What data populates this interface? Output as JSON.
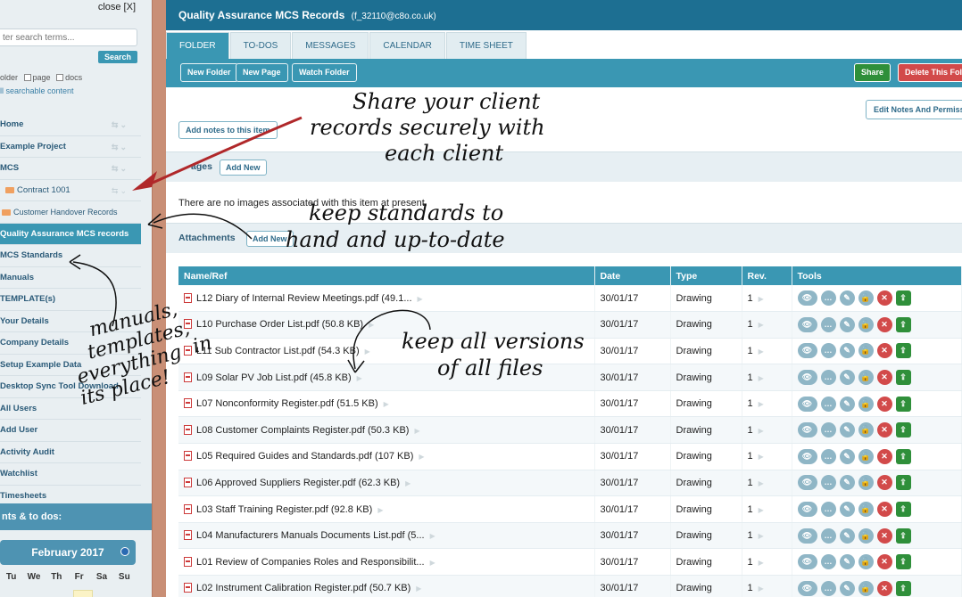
{
  "sidebar": {
    "close_label": "close [X]",
    "search": {
      "placeholder": "ter search terms..."
    },
    "search_button": "Search",
    "filters": [
      "older",
      "page",
      "docs"
    ],
    "all_searchable": "ll searchable content",
    "nav": [
      {
        "label": "Home",
        "type": "item"
      },
      {
        "label": "Example Project",
        "type": "item"
      },
      {
        "label": "MCS",
        "type": "item"
      },
      {
        "label": "Contract 1001",
        "type": "child"
      },
      {
        "label": "Customer Handover Records",
        "type": "grandchild"
      },
      {
        "label": "Quality Assurance MCS records",
        "type": "active"
      },
      {
        "label": "MCS Standards",
        "type": "item"
      },
      {
        "label": "Manuals",
        "type": "item"
      },
      {
        "label": "TEMPLATE(s)",
        "type": "item"
      },
      {
        "label": "Your Details",
        "type": "item"
      },
      {
        "label": "Company Details",
        "type": "item"
      },
      {
        "label": "Setup Example Data",
        "type": "item"
      },
      {
        "label": "Desktop Sync Tool Download",
        "type": "item"
      },
      {
        "label": "All Users",
        "type": "item"
      },
      {
        "label": "Add User",
        "type": "item"
      },
      {
        "label": "Activity Audit",
        "type": "item"
      },
      {
        "label": "Watchlist",
        "type": "item"
      },
      {
        "label": "Timesheets",
        "type": "item"
      }
    ],
    "events_header": "nts & to dos:",
    "calendar": {
      "month": "February 2017",
      "days": [
        "Tu",
        "We",
        "Th",
        "Fr",
        "Sa",
        "Su"
      ]
    }
  },
  "header": {
    "title": "Quality Assurance MCS Records",
    "subtitle": "(f_32110@c8o.co.uk)"
  },
  "tabs": [
    {
      "label": "FOLDER",
      "active": true
    },
    {
      "label": "TO-DOS",
      "active": false
    },
    {
      "label": "MESSAGES",
      "active": false
    },
    {
      "label": "CALENDAR",
      "active": false
    },
    {
      "label": "TIME SHEET",
      "active": false
    }
  ],
  "toolbar": {
    "new_folder": "New Folder",
    "new_page": "New Page",
    "watch_folder": "Watch Folder",
    "share": "Share",
    "delete": "Delete This Fold"
  },
  "notes": {
    "edit_notes": "Edit Notes And Permissio",
    "add_notes": "Add notes to this item"
  },
  "images_section": {
    "label": "ages",
    "add_button": "Add New",
    "empty_text": "There are no images associated with this item at present."
  },
  "attachments_section": {
    "label": "Attachments",
    "add_button": "Add New"
  },
  "table": {
    "columns": [
      "Name/Ref",
      "Date",
      "Type",
      "Rev.",
      "Tools"
    ],
    "rows": [
      {
        "name": "L12 Diary of Internal Review Meetings.pdf (49.1...",
        "date": "30/01/17",
        "type": "Drawing",
        "rev": "1"
      },
      {
        "name": "L10 Purchase Order List.pdf (50.8 KB)",
        "date": "30/01/17",
        "type": "Drawing",
        "rev": "1"
      },
      {
        "name": "L11 Sub Contractor List.pdf (54.3 KB)",
        "date": "30/01/17",
        "type": "Drawing",
        "rev": "1"
      },
      {
        "name": "L09 Solar PV Job List.pdf (45.8 KB)",
        "date": "30/01/17",
        "type": "Drawing",
        "rev": "1"
      },
      {
        "name": "L07 Nonconformity Register.pdf (51.5 KB)",
        "date": "30/01/17",
        "type": "Drawing",
        "rev": "1"
      },
      {
        "name": "L08 Customer Complaints Register.pdf (50.3 KB)",
        "date": "30/01/17",
        "type": "Drawing",
        "rev": "1"
      },
      {
        "name": "L05 Required Guides and Standards.pdf (107 KB)",
        "date": "30/01/17",
        "type": "Drawing",
        "rev": "1"
      },
      {
        "name": "L06 Approved Suppliers Register.pdf (62.3 KB)",
        "date": "30/01/17",
        "type": "Drawing",
        "rev": "1"
      },
      {
        "name": "L03 Staff Training Register.pdf (92.8 KB)",
        "date": "30/01/17",
        "type": "Drawing",
        "rev": "1"
      },
      {
        "name": "L04 Manufacturers Manuals Documents List.pdf (5...",
        "date": "30/01/17",
        "type": "Drawing",
        "rev": "1"
      },
      {
        "name": "L01 Review of Companies Roles and Responsibilit...",
        "date": "30/01/17",
        "type": "Drawing",
        "rev": "1"
      },
      {
        "name": "L02 Instrument Calibration Register.pdf (50.7 KB)",
        "date": "30/01/17",
        "type": "Drawing",
        "rev": "1"
      }
    ]
  },
  "annotations": {
    "share": [
      "Share your client",
      "records  securely with",
      "each client"
    ],
    "standards": [
      "keep standards to",
      "hand and up-to-date"
    ],
    "versions": [
      "keep all versions",
      "of all files"
    ],
    "manuals": [
      "manuals,",
      "templates,",
      "everything",
      "in",
      "its place!"
    ]
  },
  "colors": {
    "brand": "#1d6f92",
    "accent": "#3a97b3",
    "share": "#2f8f3a",
    "delete": "#d24a4a",
    "arrow": "#b0282a"
  }
}
